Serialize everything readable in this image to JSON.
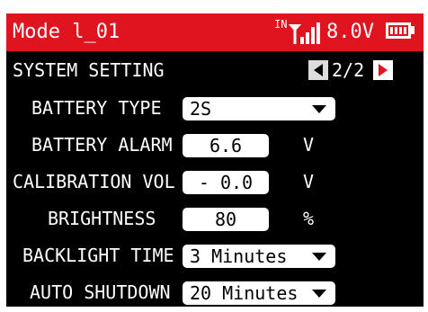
{
  "header": {
    "model_name": "Mode l_01",
    "signal_prefix": "IN",
    "voltage": "8.0V"
  },
  "page": {
    "title": "SYSTEM SETTING",
    "pager": "2/2"
  },
  "settings": [
    {
      "label": "BATTERY TYPE",
      "value": "2S",
      "unit": ""
    },
    {
      "label": "BATTERY ALARM",
      "value": "6.6",
      "unit": "V"
    },
    {
      "label": "CALIBRATION VOL",
      "value": "- 0.0",
      "unit": "V"
    },
    {
      "label": "BRIGHTNESS",
      "value": "80",
      "unit": "%"
    },
    {
      "label": "BACKLIGHT TIME",
      "value": "3 Minutes",
      "unit": ""
    },
    {
      "label": "AUTO SHUTDOWN",
      "value": "20 Minutes",
      "unit": ""
    }
  ],
  "colors": {
    "accent": "#e0141e",
    "background": "#000000",
    "field": "#ffffff"
  },
  "icons": [
    "signal-icon",
    "battery-icon",
    "page-prev-icon",
    "page-next-icon",
    "dropdown-caret-icon"
  ]
}
